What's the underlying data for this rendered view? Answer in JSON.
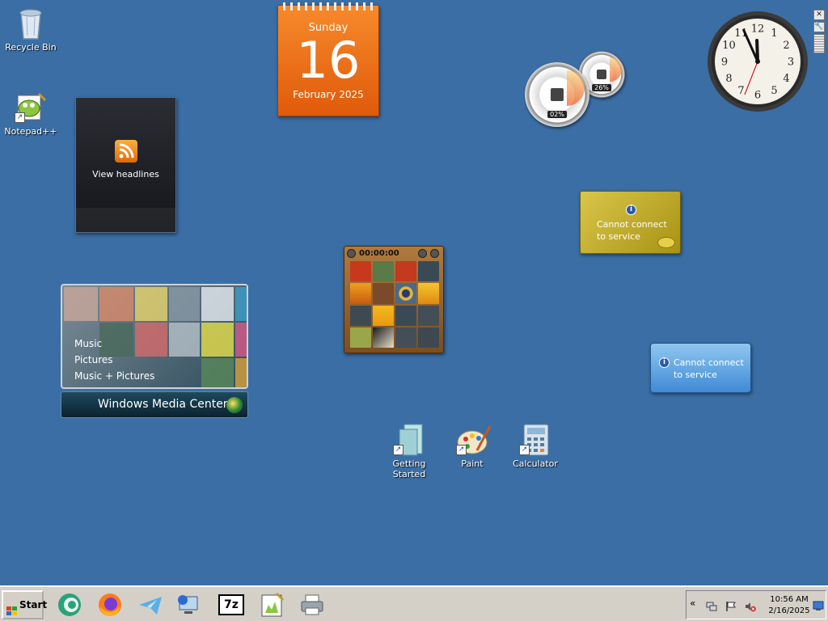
{
  "desktop": {
    "icons": [
      {
        "label": "Recycle Bin"
      },
      {
        "label": "Notepad++"
      },
      {
        "label": "Getting Started"
      },
      {
        "label": "Paint"
      },
      {
        "label": "Calculator"
      }
    ]
  },
  "gadgets": {
    "calendar": {
      "weekday": "Sunday",
      "day": "16",
      "month_year": "February 2025"
    },
    "headlines": {
      "label": "View headlines"
    },
    "media_center": {
      "menu": [
        "Music",
        "Pictures",
        "Music + Pictures"
      ],
      "brand": "Windows Media Center"
    },
    "puzzle": {
      "timer": "00:00:00"
    },
    "cpu_meter": {
      "cpu": "02%",
      "memory": "26%"
    },
    "clock": {
      "hour": 11,
      "minute": 56
    },
    "currency": {
      "message_line1": "Cannot connect",
      "message_line2": "to service"
    },
    "weather": {
      "message_line1": "Cannot connect",
      "message_line2": "to service"
    },
    "controls": {
      "close_glyph": "✕",
      "options_glyph": "🔧"
    }
  },
  "taskbar": {
    "start_label": "Start",
    "quick_launch": [
      {
        "name": "messenger"
      },
      {
        "name": "firefox"
      },
      {
        "name": "telegram"
      },
      {
        "name": "network"
      },
      {
        "name": "7zip",
        "label": "7z"
      },
      {
        "name": "notepadpp"
      },
      {
        "name": "printer"
      }
    ],
    "tray": {
      "expand_glyph": "«",
      "time": "10:56 AM",
      "date": "2/16/2025"
    }
  },
  "colors": {
    "desktop": "#3a6ea5",
    "calendar": "#f07020",
    "taskbar": "#d4d0c8"
  }
}
